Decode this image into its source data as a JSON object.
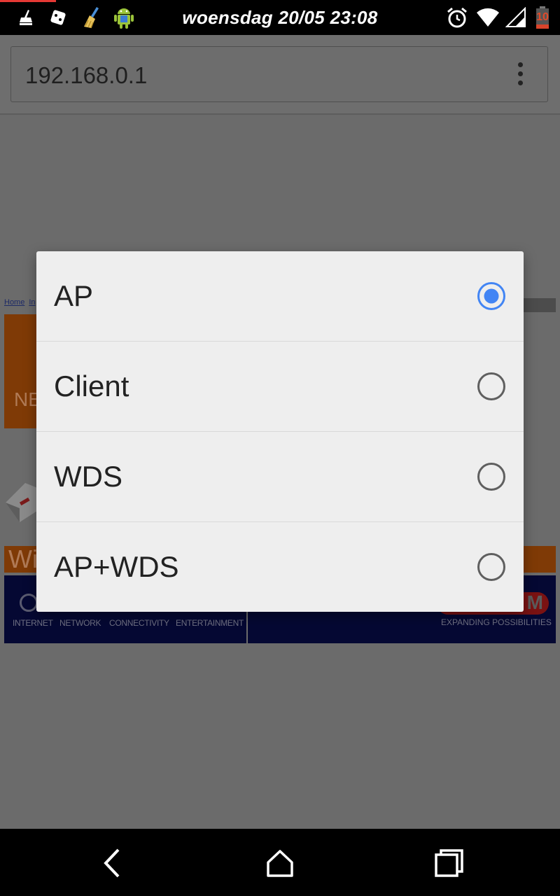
{
  "status_bar": {
    "time": "woensdag 20/05 23:08",
    "battery_level": "10",
    "left_icons": [
      "cleaner-icon",
      "dice-icon",
      "broom-icon",
      "android-icon"
    ],
    "right_icons": [
      "alarm-icon",
      "wifi-icon",
      "signal-icon",
      "battery-icon"
    ]
  },
  "browser": {
    "url": "192.168.0.1",
    "menu_icon": "overflow-menu-icon"
  },
  "background_page": {
    "link_1": "Home",
    "link_2": "In",
    "banner_fragment": "NE",
    "section_fragment": "Wi",
    "footer_labels": [
      "INTERNET",
      "NETWORK",
      "CONNECTIVITY",
      "ENTERTAINMENT"
    ],
    "brand_fragment": "M",
    "tagline": "EXPANDING POSSIBILITIES"
  },
  "dialog": {
    "options": [
      {
        "label": "AP",
        "selected": true
      },
      {
        "label": "Client",
        "selected": false
      },
      {
        "label": "WDS",
        "selected": false
      },
      {
        "label": "AP+WDS",
        "selected": false
      }
    ]
  },
  "nav_bar": {
    "buttons": [
      "back-icon",
      "home-icon",
      "recents-icon"
    ]
  },
  "colors": {
    "accent": "#4285f4",
    "scrim": "#6b6b6b",
    "dialog_bg": "#eeeeee"
  }
}
